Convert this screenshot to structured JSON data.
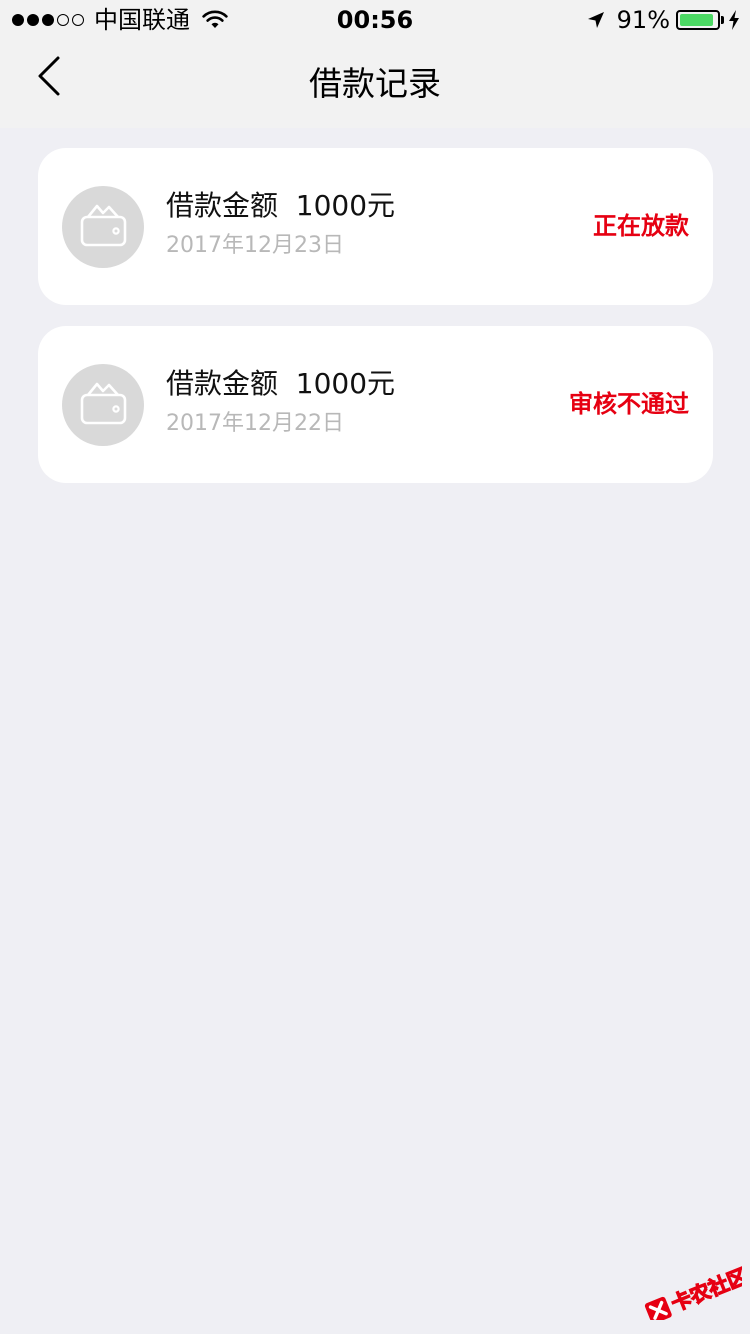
{
  "status_bar": {
    "carrier": "中国联通",
    "time": "00:56",
    "battery_percent": "91%",
    "battery_level": 0.91,
    "signal_strength": 3,
    "signal_max": 5,
    "icons": [
      "wifi-icon",
      "location-arrow-icon",
      "battery-icon",
      "charging-bolt-icon"
    ]
  },
  "nav": {
    "title": "借款记录",
    "back_icon": "chevron-left-icon"
  },
  "records": [
    {
      "amount_text": "借款金额  1000元",
      "date": "2017年12月23日",
      "status": "正在放款",
      "icon": "wallet-icon"
    },
    {
      "amount_text": "借款金额  1000元",
      "date": "2017年12月22日",
      "status": "审核不通过",
      "icon": "wallet-icon"
    }
  ],
  "colors": {
    "page_background": "#efeff4",
    "bar_background": "#f2f2f2",
    "status_red": "#e60012",
    "date_gray": "#b8b8b8",
    "badge_gray": "#d9d9d9",
    "battery_green": "#4cd964"
  },
  "watermark": {
    "text": "卡农社区",
    "icon": "kanong-logo-icon"
  }
}
